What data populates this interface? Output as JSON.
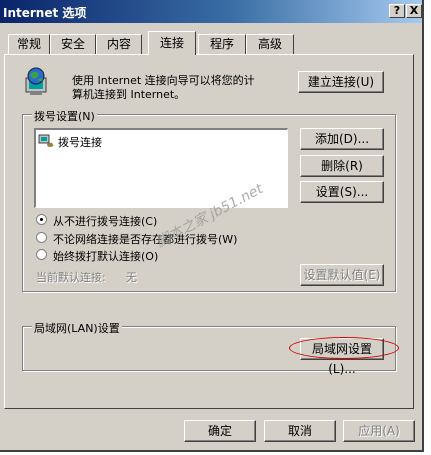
{
  "window": {
    "title": "Internet 选项",
    "help_button": "?",
    "close_button": "X"
  },
  "tabs": [
    {
      "label": "常规",
      "active": false
    },
    {
      "label": "安全",
      "active": false
    },
    {
      "label": "内容",
      "active": false
    },
    {
      "label": "连接",
      "active": true
    },
    {
      "label": "程序",
      "active": false
    },
    {
      "label": "高级",
      "active": false
    }
  ],
  "wizard": {
    "text_line1": "使用 Internet 连接向导可以将您的计",
    "text_line2": "算机连接到 Internet。",
    "button": "建立连接(U)"
  },
  "dialup": {
    "legend": "拨号设置(N)",
    "items": [
      "拨号连接"
    ],
    "add_button": "添加(D)...",
    "delete_button": "删除(R)",
    "settings_button": "设置(S)...",
    "options": [
      {
        "label": "从不进行拨号连接(C)",
        "checked": true
      },
      {
        "label": "不论网络连接是否存在都进行拨号(W)",
        "checked": false
      },
      {
        "label": "始终拨打默认连接(O)",
        "checked": false
      }
    ],
    "current_default_label": "当前默认连接:",
    "current_default_value": "无",
    "set_default_button": "设置默认值(E)"
  },
  "lan": {
    "legend": "局域网(LAN)设置",
    "button": "局域网设置(L)..."
  },
  "footer": {
    "ok_button": "确定",
    "cancel_button": "取消",
    "apply_button": "应用(A)"
  },
  "watermark": "脚本之家 jb51.net",
  "colors": {
    "face": "#d4d0c8",
    "title_start": "#0a246a",
    "title_end": "#a6caf0",
    "highlight": "#cc0000"
  }
}
